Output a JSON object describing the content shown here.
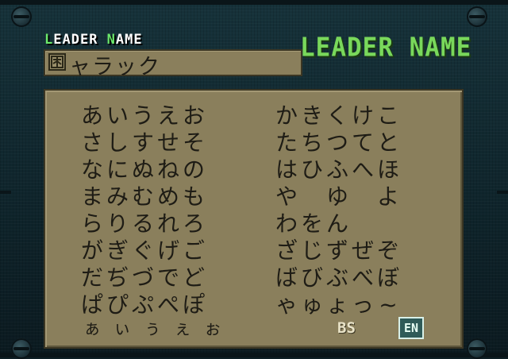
{
  "header": {
    "label_small_first": "L",
    "label_small_mid": "EADER ",
    "label_small_n": "N",
    "label_small_rest": "AME",
    "title_big": "LEADER NAME"
  },
  "name_entry": {
    "value": "ャラック"
  },
  "kana_rows": [
    [
      "あ",
      "い",
      "う",
      "え",
      "お",
      "か",
      "き",
      "く",
      "け",
      "こ"
    ],
    [
      "さ",
      "し",
      "す",
      "せ",
      "そ",
      "た",
      "ち",
      "つ",
      "て",
      "と"
    ],
    [
      "な",
      "に",
      "ぬ",
      "ね",
      "の",
      "は",
      "ひ",
      "ふ",
      "へ",
      "ほ"
    ],
    [
      "ま",
      "み",
      "む",
      "め",
      "も",
      "や",
      "",
      "ゆ",
      "",
      "よ"
    ],
    [
      "ら",
      "り",
      "る",
      "れ",
      "ろ",
      "わ",
      "を",
      "ん",
      "",
      ""
    ],
    [
      "が",
      "ぎ",
      "ぐ",
      "げ",
      "ご",
      "ざ",
      "じ",
      "ず",
      "ぜ",
      "ぞ"
    ],
    [
      "だ",
      "ぢ",
      "づ",
      "で",
      "ど",
      "ば",
      "び",
      "ぶ",
      "べ",
      "ぼ"
    ],
    [
      "ぱ",
      "ぴ",
      "ぷ",
      "ぺ",
      "ぽ",
      "ゃ",
      "ゅ",
      "ょ",
      "っ",
      "~"
    ]
  ],
  "small_kana": [
    "ぁ",
    "ぃ",
    "ぅ",
    "ぇ",
    "ぉ"
  ],
  "controls": {
    "backspace": "BS",
    "end": "EN"
  }
}
